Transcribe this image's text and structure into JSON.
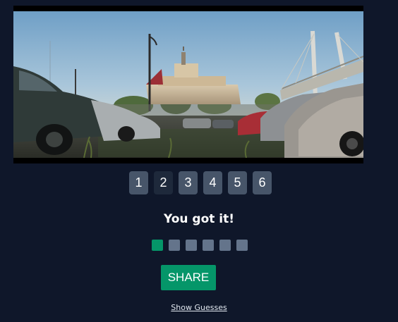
{
  "puzzle": {
    "image_label": "movie-frame",
    "guess_buttons": [
      "1",
      "2",
      "3",
      "4",
      "5",
      "6"
    ],
    "active_guess": "2"
  },
  "result": {
    "title": "You got it!",
    "attempts": [
      "correct",
      "unused",
      "unused",
      "unused",
      "unused",
      "unused"
    ]
  },
  "actions": {
    "share_label": "SHARE",
    "show_guesses_label": "Show Guesses"
  },
  "colors": {
    "background": "#0f172a",
    "button": "#475569",
    "button_active": "#1e293b",
    "correct": "#059669",
    "unused": "#64748b"
  }
}
